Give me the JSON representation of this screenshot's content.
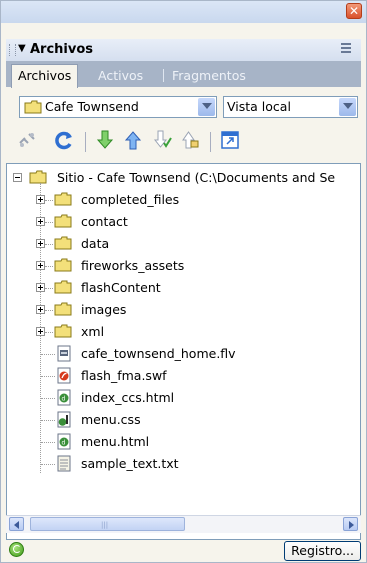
{
  "panel": {
    "title": "Archivos",
    "collapse_glyph": "▼",
    "close_glyph": "✕"
  },
  "tabs": [
    {
      "label": "Archivos",
      "active": true
    },
    {
      "label": "Activos",
      "active": false
    },
    {
      "label": "Fragmentos",
      "active": false
    }
  ],
  "site_select": {
    "value": "Cafe Townsend"
  },
  "view_select": {
    "value": "Vista local"
  },
  "toolbar": {
    "icons": [
      "connect-icon",
      "refresh-icon",
      "get-files-icon",
      "put-files-icon",
      "check-out-icon",
      "check-in-icon",
      "expand-panel-icon"
    ]
  },
  "tree": {
    "root_label": "Sitio - Cafe Townsend (C:\\Documents and Se",
    "folders": [
      "completed_files",
      "contact",
      "data",
      "fireworks_assets",
      "flashContent",
      "images",
      "xml"
    ],
    "files": [
      {
        "name": "cafe_townsend_home.flv",
        "icon": "flv-file-icon"
      },
      {
        "name": "flash_fma.swf",
        "icon": "swf-file-icon"
      },
      {
        "name": "index_ccs.html",
        "icon": "html-file-icon"
      },
      {
        "name": "menu.css",
        "icon": "css-file-icon"
      },
      {
        "name": "menu.html",
        "icon": "html-file-icon"
      },
      {
        "name": "sample_text.txt",
        "icon": "text-file-icon"
      }
    ]
  },
  "status": {
    "button_label": "Registro..."
  },
  "colors": {
    "folder": "#f3e07a",
    "folder_border": "#8a7a18",
    "accent_blue": "#2f6fd1",
    "arrow_green": "#3aa13a"
  }
}
